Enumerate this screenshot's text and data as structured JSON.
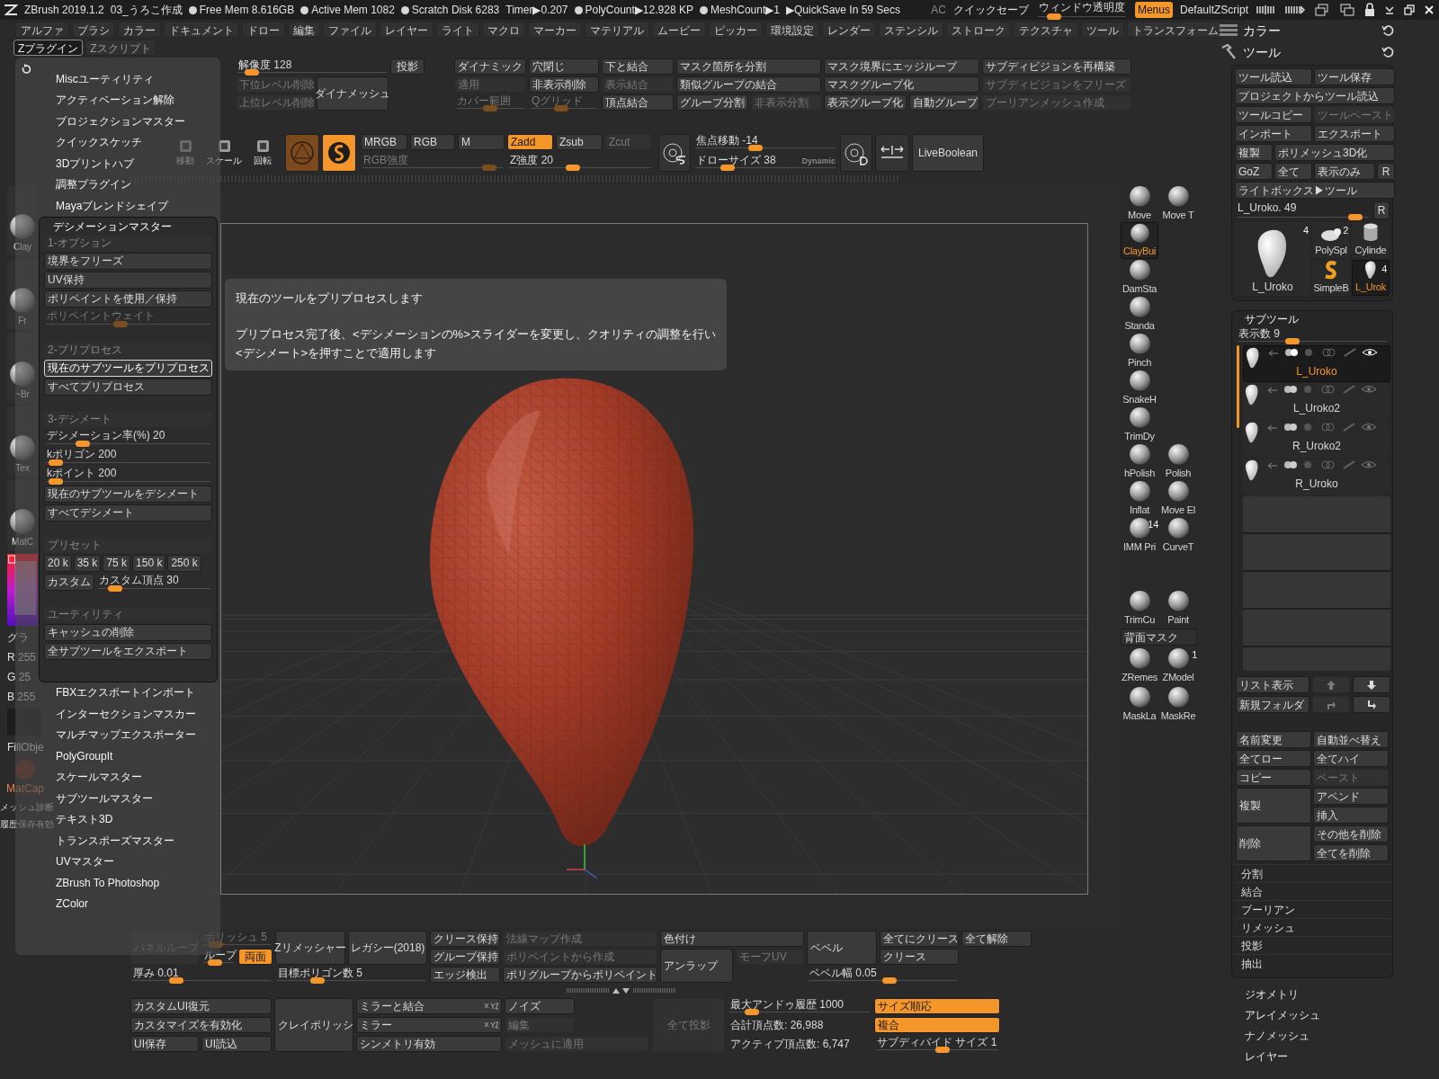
{
  "title_bar": {
    "app": "ZBrush 2019.1.2",
    "document": "03_うろこ作成",
    "stats": [
      {
        "text": "Free Mem 8.616GB",
        "dot": true
      },
      {
        "text": "Active Mem 1082",
        "dot": true
      },
      {
        "text": "Scratch Disk 6283",
        "dot": true
      },
      {
        "text": "Timer▶0.207",
        "dot": false
      },
      {
        "text": "PolyCount▶12.928 KP",
        "dot": true
      },
      {
        "text": "MeshCount▶1",
        "dot": true
      },
      {
        "text": "▶QuickSave In 59 Secs",
        "dot": false
      }
    ],
    "ac": "AC",
    "quicksave": "クイックセーブ",
    "transparency": {
      "label": "ウィンドウ透明度",
      "level": 0.12
    },
    "menus": {
      "label": "Menus",
      "on": true
    },
    "script": "DefaultZScript"
  },
  "menu_bar": [
    "アルファ",
    "ブラシ",
    "カラー",
    "ドキュメント",
    "ドロー",
    "編集",
    "ファイル",
    "レイヤー",
    "ライト",
    "マクロ",
    "マーカー",
    "マテリアル",
    "ムービー",
    "ピッカー",
    "環境設定",
    "レンダー",
    "ステンシル",
    "ストローク",
    "テクスチャ",
    "ツール",
    "トランスフォーム"
  ],
  "sub_menu_bar": [
    {
      "label": "Zプラグイン",
      "selected": true
    },
    {
      "label": "Zスクリプト",
      "selected": false
    }
  ],
  "top_shelf": {
    "geometry": [
      {
        "kind": "slider",
        "label": "解像度 128",
        "level": 0.05,
        "disabled": false
      },
      {
        "kind": "button",
        "label": "投影",
        "disabled": false
      },
      {
        "kind": "button",
        "label": "下位レベル削除",
        "disabled": true
      },
      {
        "kind": "button",
        "label": "ダイナメッシュ",
        "disabled": false
      },
      {
        "kind": "button",
        "label": "上位レベル削除",
        "disabled": true
      }
    ],
    "dynamic": [
      {
        "kind": "button",
        "label": "ダイナミック",
        "disabled": false
      },
      {
        "kind": "button",
        "label": "穴閉じ",
        "disabled": false
      },
      {
        "kind": "button",
        "label": "下と結合",
        "disabled": false
      },
      {
        "kind": "button",
        "label": "マスク箇所を分割",
        "disabled": false
      },
      {
        "kind": "button",
        "label": "マスク境界にエッジループ",
        "disabled": false
      },
      {
        "kind": "button",
        "label": "サブディビジョンを再構築",
        "disabled": false
      },
      {
        "kind": "button",
        "label": "適用",
        "disabled": true
      },
      {
        "kind": "button",
        "label": "非表示削除",
        "disabled": false
      },
      {
        "kind": "button",
        "label": "表示結合",
        "disabled": true
      },
      {
        "kind": "button",
        "label": "類似グループの結合",
        "disabled": false
      },
      {
        "kind": "button",
        "label": "マスクグループ化",
        "disabled": false
      },
      {
        "kind": "button",
        "label": "サブディビジョンをフリーズ",
        "disabled": true
      },
      {
        "kind": "slider",
        "label": "カバー範囲",
        "level": 0.5,
        "disabled": true
      },
      {
        "kind": "slider",
        "label": "Qグリッド",
        "level": 0.45,
        "disabled": true
      },
      {
        "kind": "button",
        "label": "頂点結合",
        "disabled": false
      },
      {
        "kind": "button",
        "label": "グループ分割",
        "disabled": false
      },
      {
        "kind": "button",
        "label": "非表示分割",
        "disabled": true
      },
      {
        "kind": "button",
        "label": "表示グループ化",
        "disabled": false
      },
      {
        "kind": "button",
        "label": "自動グループ",
        "disabled": false
      },
      {
        "kind": "button",
        "label": "ブーリアンメッシュ作成",
        "disabled": true
      }
    ],
    "transform_tools": [
      "移動",
      "スケール",
      "回転"
    ],
    "channels": [
      {
        "kind": "button",
        "label": "MRGB",
        "disabled": false,
        "on": false
      },
      {
        "kind": "button",
        "label": "RGB",
        "disabled": false,
        "on": false
      },
      {
        "kind": "button",
        "label": "M",
        "disabled": false,
        "on": false
      },
      {
        "kind": "button",
        "label": "Zadd",
        "disabled": false,
        "on": true
      },
      {
        "kind": "button",
        "label": "Zsub",
        "disabled": false,
        "on": false
      },
      {
        "kind": "button",
        "label": "Zcut",
        "disabled": true,
        "on": false
      }
    ],
    "intensity": [
      {
        "kind": "slider",
        "label": "RGB強度",
        "level": 0.95,
        "disabled": true
      },
      {
        "kind": "slider",
        "label": "Z強度 20",
        "level": 0.45,
        "disabled": false
      }
    ],
    "focal": {
      "label": "焦点移動 -14",
      "level": 0.42
    },
    "draw_size": {
      "label": "ドローサイズ 38",
      "level": 0.2
    },
    "dynamic_label": "Dynamic",
    "live_boolean": {
      "label": "LiveBoolean"
    }
  },
  "left_shelf": {
    "thumbs": [
      "Clay",
      "Fr",
      "~Br",
      "Tex",
      "MatC"
    ],
    "gradient": "グラ",
    "rgb": [
      "R 255",
      "G 25",
      "B 255"
    ],
    "fill": "FillObje",
    "matcap": "MatCap",
    "items": [
      "メッシュ診断",
      "履歴保存有効"
    ]
  },
  "plugin_menu": {
    "items_before": [
      "Miscユーティリティ",
      "アクティベーション解除",
      "プロジェクションマスター",
      "クイックスケッチ",
      "3Dプリントハブ",
      "調整プラグイン",
      "Mayaブレンドシェイプ"
    ],
    "decimation": {
      "title": "デシメーションマスター",
      "expanded": true,
      "sections": [
        {
          "title": "1-オプション",
          "items": [
            {
              "kind": "button",
              "label": "境界をフリーズ",
              "disabled": false
            },
            {
              "kind": "button",
              "label": "UV保持",
              "disabled": false
            },
            {
              "kind": "button",
              "label": "ポリペイントを使用／保持",
              "disabled": false
            },
            {
              "kind": "slider",
              "label": "ポリペイントウェイト",
              "level": 0.45,
              "disabled": true
            }
          ]
        },
        {
          "title": "2-プリプロセス",
          "items": [
            {
              "kind": "button",
              "label": "現在のサブツールをプリプロセス",
              "highlighted": true
            },
            {
              "kind": "button",
              "label": "すべてプリプロセス",
              "highlighted": false
            }
          ]
        },
        {
          "title": "3-デシメート",
          "items": [
            {
              "kind": "slider",
              "label": "デシメーション率(%) 20",
              "level": 0.2
            },
            {
              "kind": "slider",
              "label": "kポリゴン 200",
              "level": 0.02
            },
            {
              "kind": "slider",
              "label": "kポイント 200",
              "level": 0.02
            },
            {
              "kind": "button",
              "label": "現在のサブツールをデシメート"
            },
            {
              "kind": "button",
              "label": "すべてデシメート"
            }
          ]
        },
        {
          "title": "プリセット",
          "items": [
            {
              "kind": "row",
              "items": [
                {
                  "kind": "button",
                  "label": "20 k"
                },
                {
                  "kind": "button",
                  "label": "35 k"
                },
                {
                  "kind": "button",
                  "label": "75 k"
                },
                {
                  "kind": "button",
                  "label": "150 k"
                },
                {
                  "kind": "button",
                  "label": "250 k"
                }
              ]
            },
            {
              "kind": "row",
              "items": [
                {
                  "kind": "button",
                  "label": "カスタム"
                },
                {
                  "kind": "slider",
                  "label": "カスタム頂点 30",
                  "level": 0.1
                }
              ]
            }
          ]
        },
        {
          "title": "ユーティリティ",
          "items": [
            {
              "kind": "button",
              "label": "キャッシュの削除"
            },
            {
              "kind": "button",
              "label": "全サブツールをエクスポート"
            }
          ]
        }
      ]
    },
    "items_after": [
      "FBXエクスポートインポート",
      "インターセクションマスカー",
      "マルチマップエクスポーター",
      "PolyGroupIt",
      "スケールマスター",
      "サブツールマスター",
      "テキスト3D",
      "トランスポーズマスター",
      "UVマスター",
      "ZBrush To Photoshop",
      "ZColor"
    ]
  },
  "tooltip": {
    "lines": [
      "現在のツールをプリプロセスします",
      "プリプロセス完了後、<デシメーションの%>スライダーを変更し、クオリティの調整を行い",
      "<デシメート>を押すことで適用します"
    ]
  },
  "brushes": [
    [
      {
        "label": "Move",
        "selected": false
      },
      {
        "label": "Move T",
        "selected": false
      }
    ],
    [
      {
        "label": "ClayBui",
        "selected": true
      }
    ],
    [
      {
        "label": "DamSta",
        "selected": false
      }
    ],
    [
      {
        "label": "Standa",
        "selected": false
      }
    ],
    [
      {
        "label": "Pinch",
        "selected": false
      }
    ],
    [
      {
        "label": "SnakeH",
        "selected": false
      }
    ],
    [
      {
        "label": "TrimDy",
        "selected": false
      }
    ],
    [
      {
        "label": "hPolish",
        "selected": false
      },
      {
        "label": "Polish",
        "selected": false
      }
    ],
    [
      {
        "label": "Inflat",
        "selected": false
      },
      {
        "label": "Move El",
        "selected": false
      }
    ],
    [
      {
        "label": "IMM Pri",
        "selected": false
      },
      {
        "label": "CurveT",
        "selected": false
      }
    ],
    [
      {
        "label": "TrimCu",
        "selected": false
      },
      {
        "label": "Paint",
        "selected": false
      }
    ]
  ],
  "backface_mask": "背面マスク",
  "brushes_after": [
    [
      {
        "label": "ZRemes",
        "selected": false
      },
      {
        "label": "ZModel",
        "selected": false
      }
    ],
    [
      {
        "label": "MaskLa",
        "selected": false
      },
      {
        "label": "MaskRe",
        "selected": false
      }
    ]
  ],
  "badges": {
    "imm": "14",
    "zmodel": "1"
  },
  "bottom_shelf": {
    "upper": [
      {
        "kind": "button",
        "label": "パネルループ",
        "disabled": true,
        "on": false
      },
      {
        "kind": "slider",
        "label": "ポリッシュ 5",
        "level": 0.1,
        "disabled": true,
        "on": false
      },
      {
        "kind": "button",
        "label": "Zリメッシャー",
        "disabled": false,
        "on": false
      },
      {
        "kind": "button",
        "label": "レガシー(2018)",
        "disabled": false,
        "on": false
      },
      {
        "kind": "button",
        "label": "クリース保持",
        "disabled": false,
        "on": false
      },
      {
        "kind": "button",
        "label": "法線マップ作成",
        "disabled": true,
        "on": false
      },
      {
        "kind": "button",
        "label": "色付け",
        "disabled": false,
        "on": false
      },
      {
        "kind": "button",
        "label": "ベベル",
        "disabled": false,
        "on": false
      },
      {
        "kind": "button",
        "label": "全てにクリース",
        "disabled": false,
        "on": false
      },
      {
        "kind": "button",
        "label": "全て解除",
        "disabled": false,
        "on": false
      },
      {
        "kind": "slider",
        "label": "ループ",
        "level": 0.3,
        "disabled": false,
        "on": false
      },
      {
        "kind": "button",
        "label": "両面",
        "disabled": false,
        "on": true
      },
      {
        "kind": "button",
        "label": "グループ保持",
        "disabled": false,
        "on": false
      },
      {
        "kind": "button",
        "label": "ポリペイントから作成",
        "disabled": true,
        "on": false
      },
      {
        "kind": "button",
        "label": "アンラップ",
        "disabled": false,
        "on": false
      },
      {
        "kind": "button",
        "label": "モーフUV",
        "disabled": true,
        "on": false
      },
      {
        "kind": "button",
        "label": "クリース",
        "disabled": false,
        "on": false
      },
      {
        "kind": "slider",
        "label": "厚み 0.01",
        "level": 0.3,
        "disabled": false,
        "on": false
      },
      {
        "kind": "slider",
        "label": "目標ポリゴン数 5",
        "level": 0.25,
        "disabled": false,
        "on": false
      },
      {
        "kind": "button",
        "label": "エッジ検出",
        "disabled": false,
        "on": false
      },
      {
        "kind": "button",
        "label": "ポリグループからポリペイント",
        "disabled": false,
        "on": false
      },
      {
        "kind": "slider",
        "label": "ベベル幅 0.05",
        "level": 0.55,
        "disabled": false,
        "on": false
      }
    ],
    "lower": [
      {
        "kind": "button",
        "label": "カスタムUI復元",
        "disabled": false,
        "on": false
      },
      {
        "kind": "button",
        "label": "ミラーと結合",
        "disabled": false,
        "on": false
      },
      {
        "kind": "button",
        "label": "ノイズ",
        "disabled": false,
        "on": false
      },
      {
        "kind": "slider",
        "label": "最大アンドゥ履歴 1000",
        "level": 0.12,
        "disabled": false,
        "on": false
      },
      {
        "kind": "button",
        "label": "サイズ順応",
        "disabled": false,
        "on": true
      },
      {
        "kind": "button",
        "label": "カスタマイズを有効化",
        "disabled": false,
        "on": false
      },
      {
        "kind": "button",
        "label": "クレイポリッシ",
        "disabled": false,
        "on": false
      },
      {
        "kind": "button",
        "label": "ミラー",
        "disabled": false,
        "on": false
      },
      {
        "kind": "button",
        "label": "編集",
        "disabled": true,
        "on": false
      },
      {
        "kind": "button",
        "label": "全て投影",
        "disabled": true,
        "on": false
      },
      {
        "kind": "text",
        "label": "合計頂点数: 26,988"
      },
      {
        "kind": "button",
        "label": "複合",
        "disabled": false,
        "on": true
      },
      {
        "kind": "button",
        "label": "UI保存",
        "disabled": false,
        "on": false
      },
      {
        "kind": "button",
        "label": "UI読込",
        "disabled": false,
        "on": false
      },
      {
        "kind": "button",
        "label": "シンメトリ有効",
        "disabled": false,
        "on": false
      },
      {
        "kind": "button",
        "label": "メッシュに適用",
        "disabled": true,
        "on": false
      },
      {
        "kind": "text",
        "label": "アクティブ頂点数: 6,747"
      },
      {
        "kind": "slider",
        "label": "サブディバイド サイズ 1",
        "level": 0.55,
        "disabled": false,
        "on": false
      }
    ]
  },
  "tray": {
    "headers": [
      "カラー",
      "ツール"
    ],
    "tool_buttons": [
      {
        "kind": "button",
        "label": "ツール読込",
        "disabled": false
      },
      {
        "kind": "button",
        "label": "ツール保存",
        "disabled": false
      },
      {
        "kind": "button",
        "label": "プロジェクトからツール読込",
        "disabled": false
      },
      {
        "kind": "button",
        "label": "ツールコピー",
        "disabled": false
      },
      {
        "kind": "button",
        "label": "ツールペースト",
        "disabled": true
      },
      {
        "kind": "button",
        "label": "インポート",
        "disabled": false
      },
      {
        "kind": "button",
        "label": "エクスポート",
        "disabled": false
      },
      {
        "kind": "button",
        "label": "複製",
        "disabled": false
      },
      {
        "kind": "button",
        "label": "ポリメッシュ3D化",
        "disabled": false
      },
      {
        "kind": "button",
        "label": "GoZ",
        "disabled": false
      },
      {
        "kind": "button",
        "label": "全て",
        "disabled": false
      },
      {
        "kind": "button",
        "label": "表示のみ",
        "disabled": false
      },
      {
        "kind": "button",
        "label": "R",
        "disabled": false
      },
      {
        "kind": "button",
        "label": "ライトボックス▶ツール",
        "disabled": false
      }
    ],
    "tool_slider": {
      "label": "L_Uroko. 49",
      "level": 0.95
    },
    "tool_slider_r": {
      "label": "R"
    },
    "thumbs": [
      {
        "kind": "drop",
        "label": "L_Uroko",
        "count": "4",
        "selected": false
      },
      {
        "kind": "polysphere",
        "label": "PolySpl",
        "count": "2",
        "selected": false
      },
      {
        "kind": "cylinder",
        "label": "Cylinde",
        "selected": false
      },
      {
        "kind": "logo",
        "label": "SimpleB",
        "selected": false
      },
      {
        "kind": "drop",
        "label": "L_Urok",
        "count": "4",
        "selected": true
      }
    ],
    "subtool": {
      "title": "サブツール",
      "count": {
        "label": "表示数 9",
        "level": 0.35
      },
      "items": [
        {
          "name": "L_Uroko",
          "selected": true
        },
        {
          "name": "L_Uroko2",
          "selected": false
        },
        {
          "name": "R_Uroko2",
          "selected": false
        },
        {
          "name": "R_Uroko",
          "selected": false
        }
      ],
      "nav": [
        {
          "kind": "button",
          "label": "リスト表示",
          "disabled": false
        },
        {
          "kind": "icon",
          "disabled": true
        },
        {
          "kind": "icon",
          "disabled": false
        },
        {
          "kind": "button",
          "label": "新規フォルダ",
          "disabled": false
        },
        {
          "kind": "icon",
          "disabled": true
        },
        {
          "kind": "icon",
          "disabled": false
        }
      ],
      "actions": [
        {
          "kind": "button",
          "label": "名前変更",
          "disabled": false
        },
        {
          "kind": "button",
          "label": "自動並べ替え",
          "disabled": false
        },
        {
          "kind": "button",
          "label": "全てロー",
          "disabled": false
        },
        {
          "kind": "button",
          "label": "全てハイ",
          "disabled": false
        },
        {
          "kind": "button",
          "label": "コピー",
          "disabled": false
        },
        {
          "kind": "button",
          "label": "ペースト",
          "disabled": true
        },
        {
          "kind": "button",
          "label": "アペンド",
          "disabled": false
        },
        {
          "kind": "button",
          "label": "複製",
          "disabled": false
        },
        {
          "kind": "button",
          "label": "挿入",
          "disabled": false
        },
        {
          "kind": "button",
          "label": "その他を削除",
          "disabled": false
        },
        {
          "kind": "button",
          "label": "削除",
          "disabled": false
        },
        {
          "kind": "button",
          "label": "全てを削除",
          "disabled": false
        }
      ],
      "sections": [
        "分割",
        "結合",
        "ブーリアン",
        "リメッシュ",
        "投影",
        "抽出"
      ]
    },
    "more": [
      "ジオメトリ",
      "アレイメッシュ",
      "ナノメッシュ",
      "レイヤー"
    ]
  }
}
